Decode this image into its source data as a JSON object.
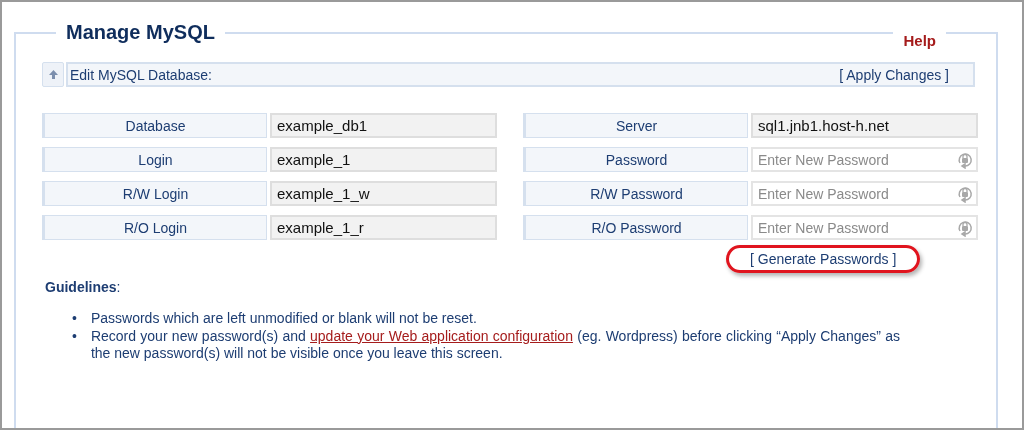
{
  "page": {
    "title": "Manage MySQL",
    "help": "Help"
  },
  "toolbar": {
    "title": "Edit MySQL Database:",
    "apply": "[ Apply Changes ]"
  },
  "left_fields": [
    {
      "label": "Database",
      "value": "example_db1"
    },
    {
      "label": "Login",
      "value": "example_1"
    },
    {
      "label": "R/W Login",
      "value": "example_1_w"
    },
    {
      "label": "R/O Login",
      "value": "example_1_r"
    }
  ],
  "right_fields": [
    {
      "label": "Server",
      "kind": "text",
      "value": "sql1.jnb1.host-h.net"
    },
    {
      "label": "Password",
      "kind": "password",
      "placeholder": "Enter New Password"
    },
    {
      "label": "R/W Password",
      "kind": "password",
      "placeholder": "Enter New Password"
    },
    {
      "label": "R/O Password",
      "kind": "password",
      "placeholder": "Enter New Password"
    }
  ],
  "generate": {
    "label": "[ Generate Passwords ]",
    "highlighted": true
  },
  "guidelines": {
    "heading": "**Guidelines**:",
    "items": [
      {
        "bullet": "•",
        "text": "Passwords which are left unmodified or blank will not be reset."
      },
      {
        "bullet": "•",
        "text": "Record your new password(s) and ",
        "link": "update your Web application configuration",
        "after": " (eg. Wordpress) before clicking “Apply Changes” as the new password(s) will not be visible once you leave this screen."
      }
    ]
  }
}
